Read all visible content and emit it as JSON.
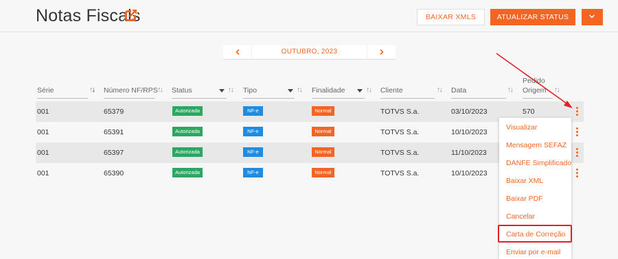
{
  "header": {
    "title": "Notas Fiscais",
    "download_xmls_label": "BAIXAR XMLS",
    "update_status_label": "ATUALIZAR STATUS"
  },
  "period": {
    "label": "OUTUBRO, 2023"
  },
  "table": {
    "columns": [
      "Série",
      "Número NF/RPS",
      "Status",
      "Tipo",
      "Finalidade",
      "Cliente",
      "Data",
      "Pedido",
      "Origem"
    ],
    "rows": [
      {
        "serie": "001",
        "numero": "65379",
        "status": "Autorizada",
        "tipo": "NF-e",
        "finalidade": "Normal",
        "cliente": "TOTVS S.a.",
        "data": "03/10/2023",
        "pedido": "570"
      },
      {
        "serie": "001",
        "numero": "65391",
        "status": "Autorizada",
        "tipo": "NF-e",
        "finalidade": "Normal",
        "cliente": "TOTVS S.a.",
        "data": "10/10/2023",
        "pedido": ""
      },
      {
        "serie": "001",
        "numero": "65397",
        "status": "Autorizada",
        "tipo": "NF-e",
        "finalidade": "Normal",
        "cliente": "TOTVS S.a.",
        "data": "11/10/2023",
        "pedido": ""
      },
      {
        "serie": "001",
        "numero": "65390",
        "status": "Autorizada",
        "tipo": "NF-e",
        "finalidade": "Normal",
        "cliente": "TOTVS S.a.",
        "data": "10/10/2023",
        "pedido": ""
      }
    ]
  },
  "menu": {
    "items": [
      "Visualizar",
      "Mensagem SEFAZ",
      "DANFE Simplificado",
      "Baixar XML",
      "Baixar PDF",
      "Cancelar",
      "Carta de Correção",
      "Enviar por e-mail"
    ]
  },
  "colors": {
    "accent": "#f26522",
    "status_green": "#2aa862",
    "type_blue": "#1e8ce0",
    "annotation_red": "#e02020"
  },
  "icons": [
    "external-link-icon",
    "chevron-down-icon",
    "chevron-left-icon",
    "chevron-right-icon",
    "sort-icon",
    "filter-caret-icon",
    "kebab-menu-icon",
    "annotation-arrow"
  ]
}
